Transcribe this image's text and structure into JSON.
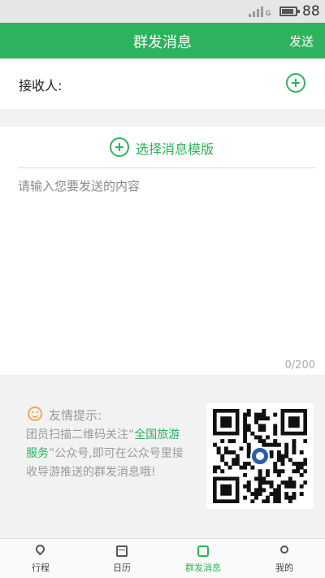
{
  "status_bar": {
    "net_type": "G",
    "battery_level": "88"
  },
  "header": {
    "title": "群发消息",
    "send_label": "发送"
  },
  "recipient": {
    "label": "接收人:"
  },
  "compose": {
    "template_label": "选择消息模版",
    "placeholder": "请输入您要发送的内容",
    "char_count": "0/200"
  },
  "tip": {
    "title": "友情提示:",
    "text_before": "团员扫描二维码关注“",
    "highlight": "全国旅游服务",
    "text_after": "”公众号,即可在公众号里接收导游推送的群发消息哦!"
  },
  "tabs": [
    {
      "label": "行程",
      "icon": "location-pin-icon"
    },
    {
      "label": "日历",
      "icon": "calendar-icon"
    },
    {
      "label": "群发消息",
      "icon": "message-icon"
    },
    {
      "label": "我的",
      "icon": "user-icon"
    }
  ],
  "colors": {
    "accent": "#2db35d",
    "tip_icon": "#f0a85a"
  }
}
